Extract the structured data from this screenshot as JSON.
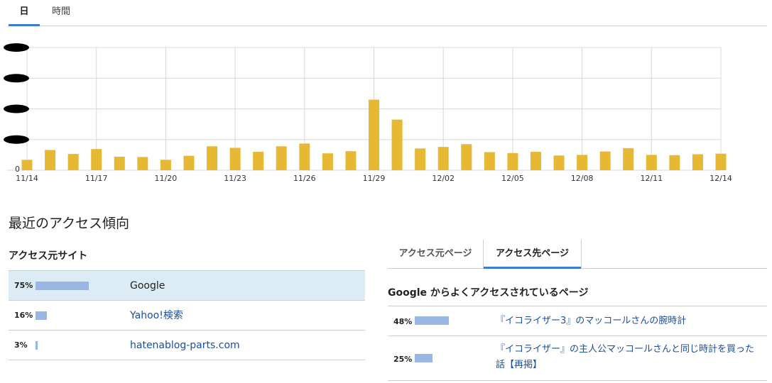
{
  "tabs": {
    "day": "日",
    "hour": "時間"
  },
  "chart_data": {
    "type": "bar",
    "ytick_zero": "0",
    "xticks": [
      "11/14",
      "11/17",
      "11/20",
      "11/23",
      "11/26",
      "11/29",
      "12/02",
      "12/05",
      "12/08",
      "12/11",
      "12/14"
    ],
    "values": [
      34,
      66,
      53,
      69,
      44,
      43,
      34,
      47,
      78,
      73,
      60,
      78,
      87,
      55,
      62,
      230,
      165,
      71,
      76,
      85,
      59,
      56,
      60,
      48,
      50,
      61,
      72,
      50,
      49,
      52,
      54
    ],
    "ylim": [
      0,
      400
    ],
    "bar_color": "#e7b833"
  },
  "recent_title": "最近のアクセス傾向",
  "sources": {
    "title": "アクセス元サイト",
    "items": [
      {
        "pct": "75%",
        "value": 75,
        "label": "Google"
      },
      {
        "pct": "16%",
        "value": 16,
        "label": "Yahoo!検索"
      },
      {
        "pct": "3%",
        "value": 3,
        "label": "hatenablog-parts.com"
      }
    ]
  },
  "pages": {
    "tab_from": "アクセス元ページ",
    "tab_to": "アクセス先ページ",
    "title": "Google からよくアクセスされているページ",
    "items": [
      {
        "pct": "48%",
        "value": 48,
        "label": "『イコライザー3』のマッコールさんの腕時計"
      },
      {
        "pct": "25%",
        "value": 25,
        "label": "『イコライザー』の主人公マッコールさんと同じ時計を買った話【再掲】"
      }
    ]
  }
}
